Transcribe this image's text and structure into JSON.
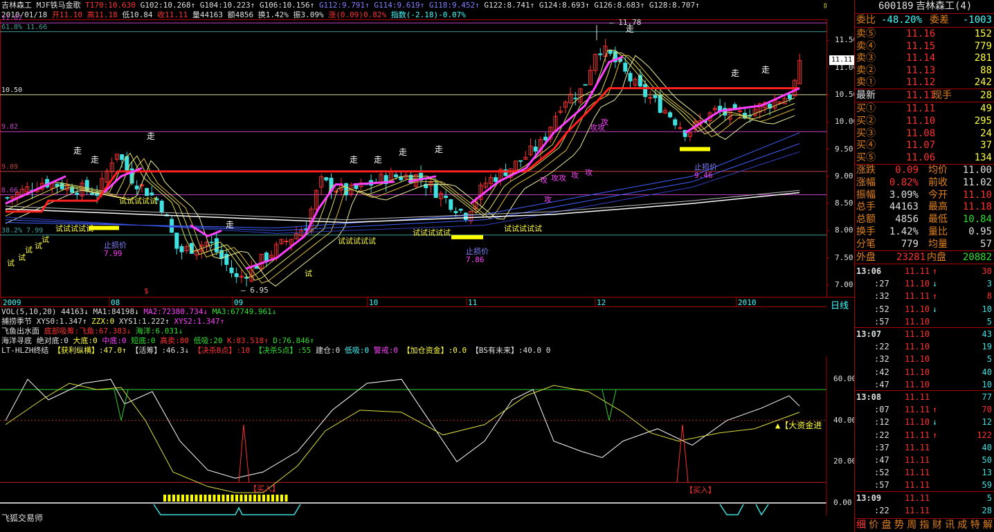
{
  "header": {
    "title": "吉林森工",
    "indicator": "MJF铁马金歌",
    "t170": "T170:10.630",
    "g102": "G102:10.268↑",
    "g104": "G104:10.223↑",
    "g106": "G106:10.156↑",
    "g112": "G112:9.791↑",
    "g114": "G114:9.619↑",
    "g118": "G118:9.452↑",
    "g122": "G122:8.741↑",
    "g124": "G124:8.693↑",
    "g126": "G126:8.683↑",
    "g128": "G128:8.707↑",
    "date": "2010/01/18",
    "open": "开11.10",
    "high": "高11.18",
    "low": "低10.84",
    "close": "收11.11",
    "vol": "量44163",
    "amt": "额4856",
    "turn": "换1.42%",
    "amp": "振3.09%",
    "chg": "涨(0.09)0.82%",
    "idx": "指数(-2.18)-0.07%"
  },
  "main_chart": {
    "y_labels": [
      "11.50",
      "11.00",
      "10.50",
      "10.00",
      "9.50",
      "9.00",
      "8.50",
      "8.00",
      "7.50",
      "7.00"
    ],
    "x_labels": [
      "2009",
      "08",
      "09",
      "10",
      "11",
      "12",
      "2010"
    ],
    "period": "日线",
    "left_levels": [
      "11.82",
      "61.8% 11.66",
      "10.50",
      "9.82",
      "9.09",
      "8.66",
      "38.2% 7.99"
    ],
    "price_tag": "11.11",
    "annot": {
      "high": "11.78",
      "low": "6.95",
      "stop1": "止损价",
      "stop1v": "7.99",
      "stop2": "止损价",
      "stop2v": "7.86",
      "stop3": "止损价",
      "stop3v": "9.46",
      "zou": "走",
      "shi": "试",
      "gong": "攻",
      "gongji": "攻攻",
      "shishi": "试试试试试",
      "s": "$"
    }
  },
  "vol_panel": {
    "label": "VOL(5,10,20)",
    "v": "44163↓",
    "ma1": "MA1:84198↓",
    "ma2": "MA2:72380.734↓",
    "ma3": "MA3:67749.961↓"
  },
  "ind_lines": [
    {
      "a": "捕捞季节",
      "b": "XYS0:1.347↑",
      "c": "ZZX:0",
      "d": "XYS1:1.222↑",
      "e": "XYS2:1.347↑"
    },
    {
      "a": "飞鱼出水面",
      "b": "底部吸筹:飞鱼:67.383↓",
      "c": "海洋:6.031↓"
    },
    {
      "a": "海洋寻底",
      "b": "绝对底:0",
      "c": "大底:0",
      "d": "中底:0",
      "e": "短底:0",
      "f": "高卖:80",
      "g": "低吸:20",
      "h": "K:83.518↑",
      "i": "D:76.846↑"
    },
    {
      "a": "LT-HLZH终结",
      "b": "【获利纵横】:47.0↑",
      "c": "【活筹】:46.3↓",
      "d": "【决杀B点】:10",
      "e": "【决杀S点】:55",
      "f": "建仓:0",
      "g": "低吸:0",
      "h": "警戒:0",
      "i": "【加仓资金】:0.0",
      "j": "【BS有未来】:40.0 0"
    }
  ],
  "osc": {
    "y_labels": [
      "60.00",
      "40.00",
      "20.00",
      "0.00"
    ],
    "buy1": "【买入】",
    "buy2": "【买入】",
    "bigfund": "▲【大资金进",
    "footer": "飞狐交易师"
  },
  "quote": {
    "code": "600189",
    "name": "吉林森工(4)",
    "weibi_l": "委比",
    "weibi": "-48.20%",
    "weicha_l": "委差",
    "weicha": "-1003",
    "asks": [
      {
        "l": "卖⑤",
        "p": "11.16",
        "v": "152"
      },
      {
        "l": "卖④",
        "p": "11.15",
        "v": "779"
      },
      {
        "l": "卖③",
        "p": "11.14",
        "v": "281"
      },
      {
        "l": "卖②",
        "p": "11.13",
        "v": "88"
      },
      {
        "l": "卖①",
        "p": "11.12",
        "v": "242"
      }
    ],
    "last_l": "最新",
    "last": "11.11",
    "xs_l": "现手",
    "xs": "28",
    "bids": [
      {
        "l": "买①",
        "p": "11.11",
        "v": "49"
      },
      {
        "l": "买②",
        "p": "11.10",
        "v": "295"
      },
      {
        "l": "买③",
        "p": "11.08",
        "v": "24"
      },
      {
        "l": "买④",
        "p": "11.07",
        "v": "37"
      },
      {
        "l": "买⑤",
        "p": "11.06",
        "v": "134"
      }
    ],
    "stats": [
      {
        "a": "涨跌",
        "av": "0.09",
        "b": "均价",
        "bv": "11.00",
        "ac": "r",
        "bc": "w"
      },
      {
        "a": "涨幅",
        "av": "0.82%",
        "b": "前收",
        "bv": "11.02",
        "ac": "r",
        "bc": "w"
      },
      {
        "a": "振幅",
        "av": "3.09%",
        "b": "今开",
        "bv": "11.10",
        "ac": "w",
        "bc": "r"
      },
      {
        "a": "总手",
        "av": "44163",
        "b": "最高",
        "bv": "11.18",
        "ac": "w",
        "bc": "r"
      },
      {
        "a": "总额",
        "av": "4856",
        "b": "最低",
        "bv": "10.84",
        "ac": "w",
        "bc": "g"
      },
      {
        "a": "换手",
        "av": "1.42%",
        "b": "量比",
        "bv": "0.95",
        "ac": "w",
        "bc": "w"
      },
      {
        "a": "分笔",
        "av": "779",
        "b": "均量",
        "bv": "57",
        "ac": "w",
        "bc": "w"
      }
    ],
    "outer_l": "外盘",
    "outer": "23281",
    "inner_l": "内盘",
    "inner": "20882",
    "ticks": [
      {
        "t": "13:06",
        "p": "11.11",
        "d": "↑",
        "v": "30"
      },
      {
        "t": ":27",
        "p": "11.10",
        "d": "↓",
        "v": "3"
      },
      {
        "t": ":32",
        "p": "11.11",
        "d": "↑",
        "v": "8"
      },
      {
        "t": ":52",
        "p": "11.10",
        "d": "↓",
        "v": "10"
      },
      {
        "t": ":57",
        "p": "11.10",
        "d": "",
        "v": "5"
      },
      {
        "t": "13:07",
        "p": "11.10",
        "d": "",
        "v": "43"
      },
      {
        "t": ":22",
        "p": "11.10",
        "d": "",
        "v": "19"
      },
      {
        "t": ":32",
        "p": "11.10",
        "d": "",
        "v": "5"
      },
      {
        "t": ":42",
        "p": "11.10",
        "d": "",
        "v": "40"
      },
      {
        "t": ":47",
        "p": "11.10",
        "d": "",
        "v": "10"
      },
      {
        "t": "13:08",
        "p": "11.11",
        "d": "",
        "v": "77"
      },
      {
        "t": ":07",
        "p": "11.11",
        "d": "↑",
        "v": "70"
      },
      {
        "t": ":12",
        "p": "11.10",
        "d": "↓",
        "v": "12"
      },
      {
        "t": ":22",
        "p": "11.11",
        "d": "↑",
        "v": "122"
      },
      {
        "t": ":37",
        "p": "11.11",
        "d": "",
        "v": "40"
      },
      {
        "t": ":47",
        "p": "11.11",
        "d": "",
        "v": "50"
      },
      {
        "t": ":52",
        "p": "11.11",
        "d": "",
        "v": "13"
      },
      {
        "t": ":57",
        "p": "11.11",
        "d": "",
        "v": "59"
      },
      {
        "t": "13:09",
        "p": "11.11",
        "d": "",
        "v": "5"
      },
      {
        "t": ":22",
        "p": "11.11",
        "d": "",
        "v": "28"
      }
    ],
    "footer": [
      "细",
      "价",
      "盘",
      "势",
      "周",
      "指",
      "财",
      "讯",
      "成",
      "特",
      "解"
    ]
  },
  "colors": {
    "up": "#ff3030",
    "down": "#40e0e0",
    "accent": "#ffff40"
  }
}
